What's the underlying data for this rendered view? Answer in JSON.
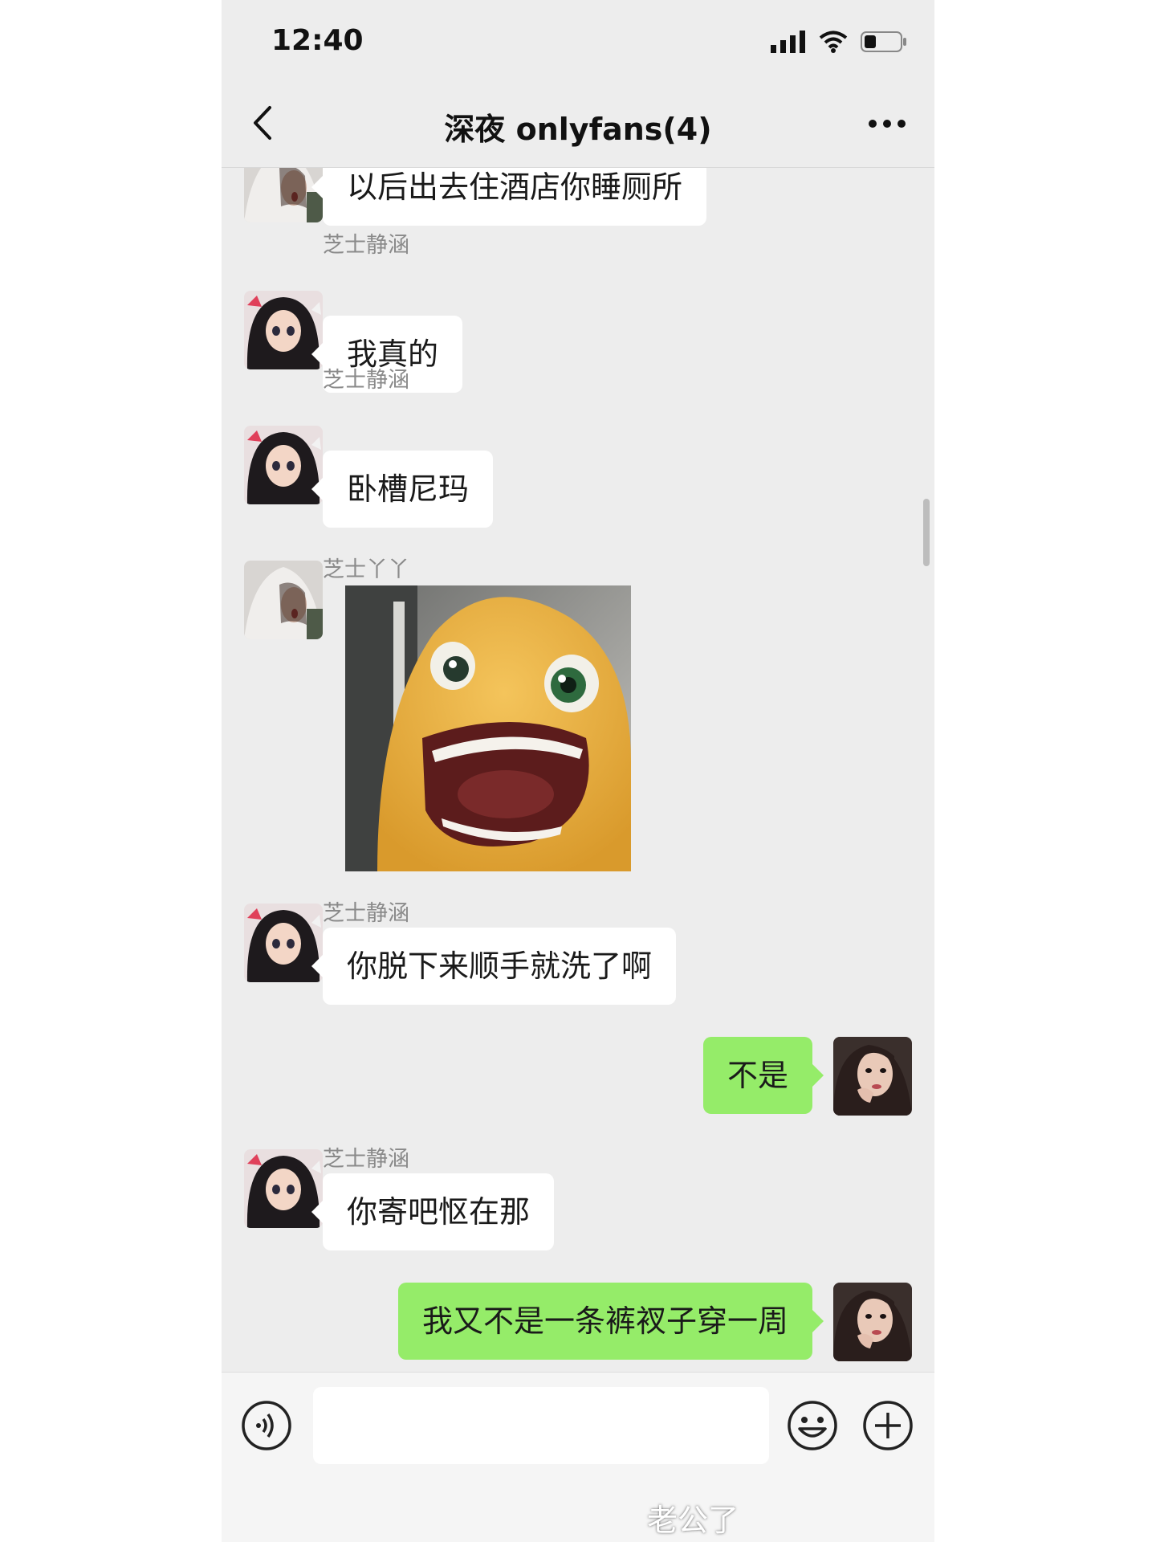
{
  "status": {
    "time": "12:40"
  },
  "nav": {
    "title": "深夜 onlyfans(4)"
  },
  "messages": [
    {
      "sender": "",
      "text": "以后出去住酒店你睡厕所"
    },
    {
      "sender": "芝士静涵",
      "text": "我真的"
    },
    {
      "sender": "芝士静涵",
      "text": "卧槽尼玛"
    },
    {
      "sender": "芝士丫丫",
      "text": ""
    },
    {
      "sender": "芝士静涵",
      "text": "你脱下来顺手就洗了啊"
    },
    {
      "sender": "",
      "text": "不是"
    },
    {
      "sender": "芝士静涵",
      "text": "你寄吧怄在那"
    },
    {
      "sender": "",
      "text": "我又不是一条裤衩子穿一周"
    }
  ],
  "watermark": "老公了",
  "colors": {
    "bg": "#ededed",
    "out_bubble": "#95ec69",
    "in_bubble": "#ffffff"
  }
}
